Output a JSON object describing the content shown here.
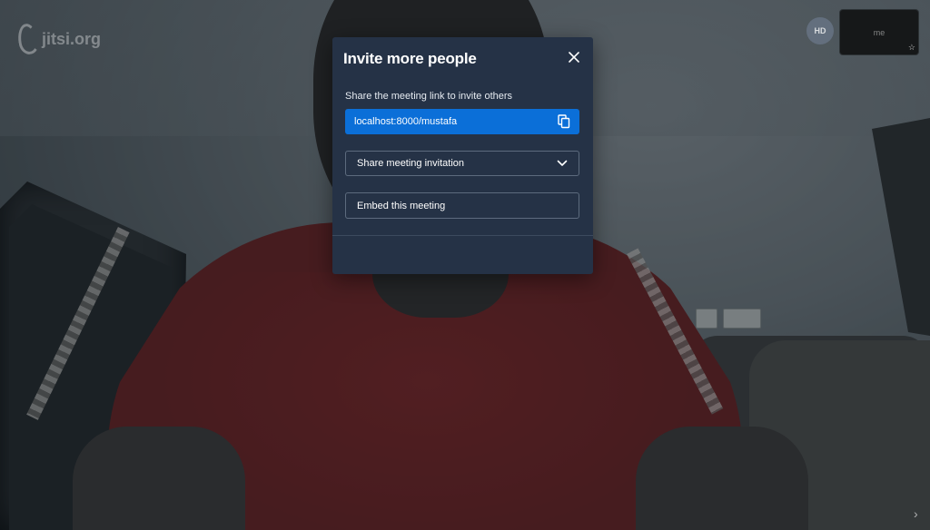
{
  "watermark": {
    "text": "jitsi.org"
  },
  "participant_badge": {
    "text": "HD"
  },
  "local_thumbnail": {
    "label": "me"
  },
  "dialog": {
    "title": "Invite more people",
    "share_label": "Share the meeting link to invite others",
    "meeting_link": "localhost:8000/mustafa",
    "share_invitation_label": "Share meeting invitation",
    "embed_label": "Embed this meeting"
  },
  "colors": {
    "dialog_background": "#253246",
    "link_box": "#0b6fd8",
    "border": "#5d6b7e"
  },
  "icons": {
    "close": "close-icon",
    "copy": "copy-icon",
    "chevron": "chevron-down-icon",
    "star": "star-icon",
    "filmstrip": "chevron-right-icon"
  }
}
